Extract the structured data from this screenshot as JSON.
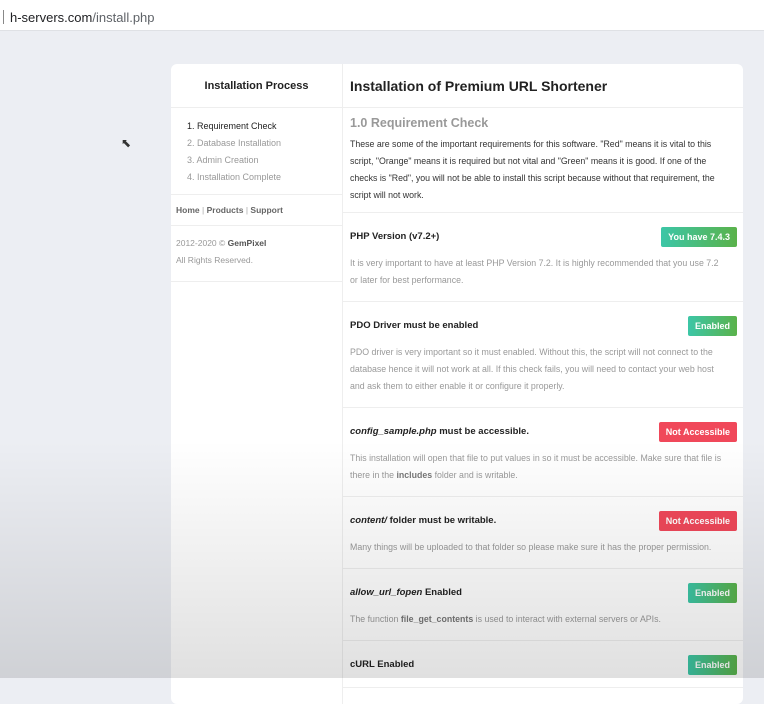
{
  "browser": {
    "url_host": "h-servers.com",
    "url_path": "/install.php"
  },
  "sidebar": {
    "title": "Installation Process",
    "steps": [
      "1. Requirement Check",
      "2. Database Installation",
      "3. Admin Creation",
      "4. Installation Complete"
    ],
    "links": [
      "Home",
      "Products",
      "Support"
    ],
    "link_sep": "|",
    "copyright_years": "2012-2020 ©",
    "copyright_brand": "GemPixel",
    "rights": "All Rights Reserved."
  },
  "main": {
    "title": "Installation of Premium URL Shortener",
    "section_title": "1.0 Requirement Check",
    "intro": "These are some of the important requirements for this software. \"Red\" means it is vital to this script, \"Orange\" means it is required but not vital and \"Green\" means it is good. If one of the checks is \"Red\", you will not be able to install this script because without that requirement, the script will not work.",
    "checks": [
      {
        "em": "",
        "title": "PHP Version (v7.2+)",
        "badge": "You have 7.4.3",
        "status": "ok",
        "desc_pre": "It is very important to have at least PHP Version 7.2. It is highly recommended that you use 7.2 or later for best performance.",
        "desc_bold": "",
        "desc_post": ""
      },
      {
        "em": "",
        "title": "PDO Driver must be enabled",
        "badge": "Enabled",
        "status": "ok",
        "desc_pre": "PDO driver is very important so it must enabled. Without this, the script will not connect to the database hence it will not work at all. If this check fails, you will need to contact your web host and ask them to either enable it or configure it properly.",
        "desc_bold": "",
        "desc_post": ""
      },
      {
        "em": "config_sample.php",
        "title": " must be accessible.",
        "badge": "Not Accessible",
        "status": "bad",
        "desc_pre": "This installation will open that file to put values in so it must be accessible. Make sure that file is there in the ",
        "desc_bold": "includes",
        "desc_post": " folder and is writable."
      },
      {
        "em": "content/",
        "title": " folder must be writable.",
        "badge": "Not Accessible",
        "status": "bad",
        "desc_pre": "Many things will be uploaded to that folder so please make sure it has the proper permission.",
        "desc_bold": "",
        "desc_post": ""
      },
      {
        "em": "allow_url_fopen",
        "title": " Enabled",
        "badge": "Enabled",
        "status": "ok",
        "desc_pre": "The function ",
        "desc_bold": "file_get_contents",
        "desc_post": " is used to interact with external servers or APIs."
      },
      {
        "em": "",
        "title": "cURL Enabled",
        "badge": "Enabled",
        "status": "ok",
        "desc_pre": "",
        "desc_bold": "",
        "desc_post": ""
      }
    ]
  },
  "colors": {
    "ok_start": "#3cc6a7",
    "ok_end": "#5ab24a",
    "bad": "#f0485a"
  }
}
